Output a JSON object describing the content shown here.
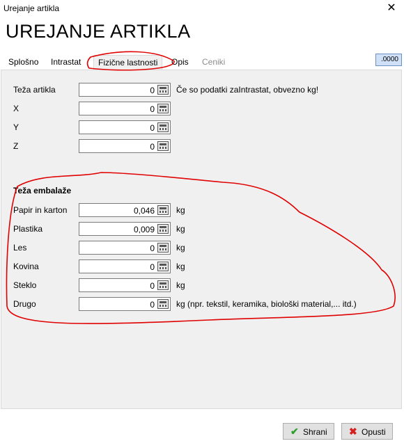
{
  "window": {
    "title": "Urejanje artikla",
    "close_glyph": "✕"
  },
  "heading": "UREJANJE ARTIKLA",
  "tabs": [
    {
      "label": "Splošno",
      "state": "normal"
    },
    {
      "label": "Intrastat",
      "state": "normal"
    },
    {
      "label": "Fizične lastnosti",
      "state": "active"
    },
    {
      "label": "Opis",
      "state": "normal"
    },
    {
      "label": "Ceniki",
      "state": "disabled"
    }
  ],
  "badge": ".0000",
  "dimensions": [
    {
      "label": "Teža artikla",
      "value": "0",
      "note": "Če so podatki zaIntrastat, obvezno kg!"
    },
    {
      "label": "X",
      "value": "0"
    },
    {
      "label": "Y",
      "value": "0"
    },
    {
      "label": "Z",
      "value": "0"
    }
  ],
  "packaging": {
    "title": "Teža embalaže",
    "unit": "kg",
    "drugo_note": "kg (npr. tekstil, keramika, biološki material,... itd.)",
    "rows": [
      {
        "label": "Papir in karton",
        "value": "0,046"
      },
      {
        "label": "Plastika",
        "value": "0,009"
      },
      {
        "label": "Les",
        "value": "0"
      },
      {
        "label": "Kovina",
        "value": "0"
      },
      {
        "label": "Steklo",
        "value": "0"
      },
      {
        "label": "Drugo",
        "value": "0"
      }
    ]
  },
  "buttons": {
    "save": "Shrani",
    "cancel": "Opusti"
  },
  "icons": {
    "field": "calculator-icon",
    "save": "checkmark-icon",
    "cancel": "x-icon"
  },
  "colors": {
    "annotation": "#e00000",
    "save_icon": "#2e9e2e",
    "cancel_icon": "#d62020",
    "badge_bg": "#cfe0f7"
  }
}
